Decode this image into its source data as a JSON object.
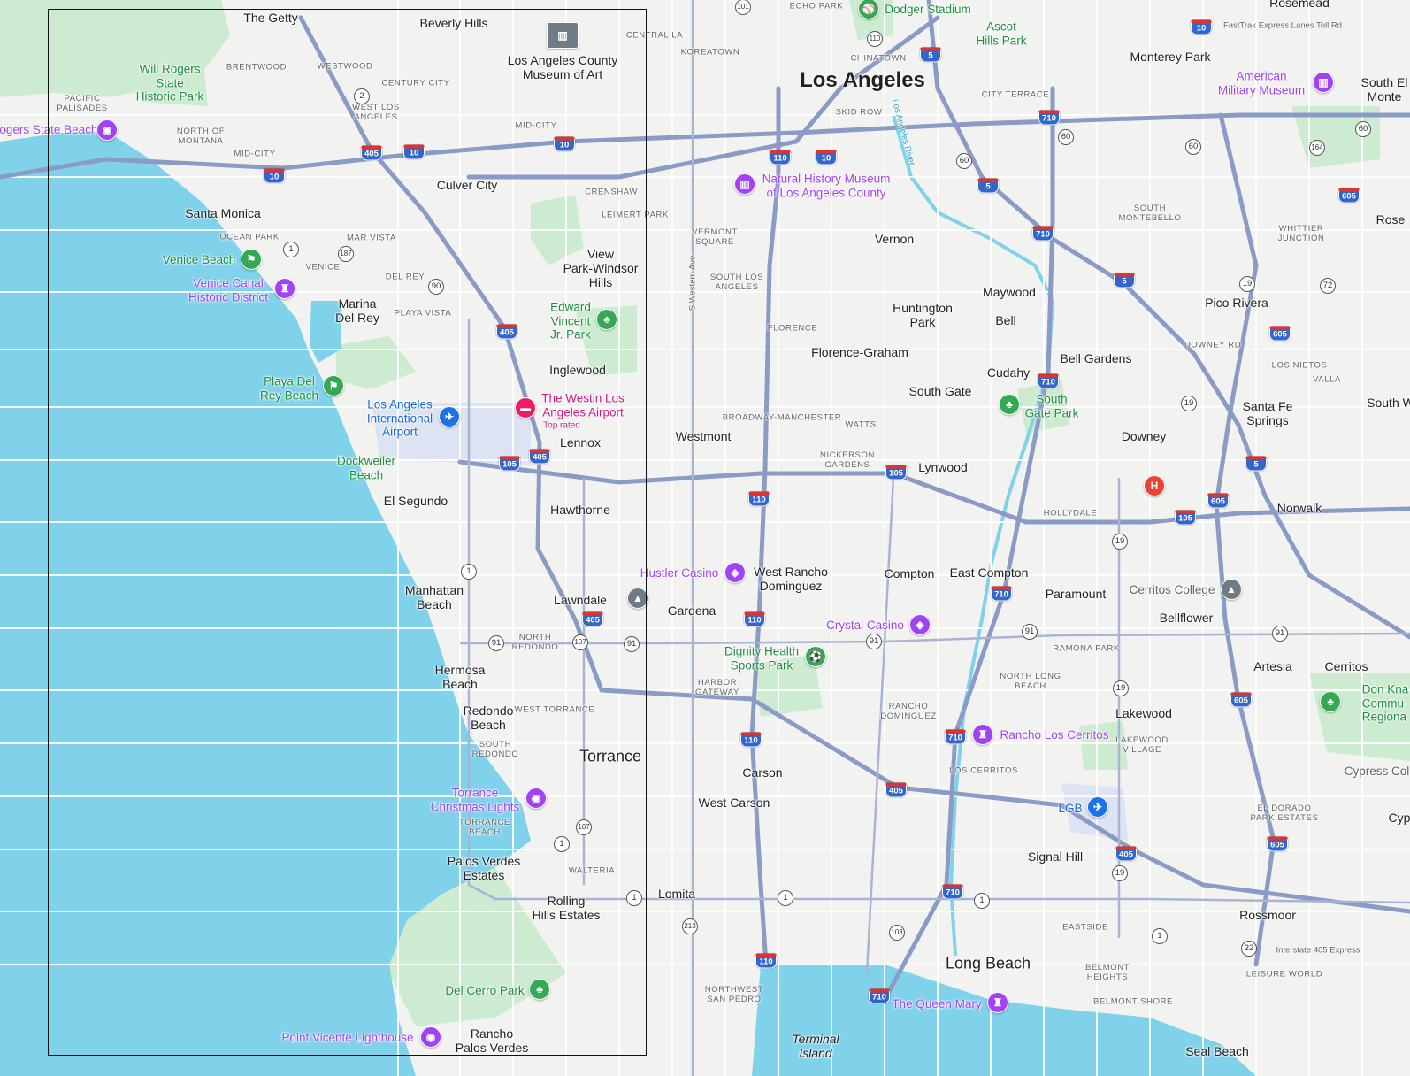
{
  "places": {
    "the_getty": "The Getty",
    "beverly_hills": "Beverly Hills",
    "brentwood": "BRENTWOOD",
    "westwood": "WESTWOOD",
    "will_rogers": "Will Rogers\nState\nHistoric Park",
    "pacific_palisades": "PACIFIC\nPALISADES",
    "rogers_state_beach": "Rogers State Beach",
    "century_city": "CENTURY CITY",
    "west_la": "WEST LOS\nANGELES",
    "north_montana": "NORTH OF\nMONTANA",
    "mid_city_west": "MID-CITY",
    "mid_city": "MID-CITY",
    "lacma": "Los Angeles County\nMuseum of Art",
    "central_la": "CENTRAL LA",
    "koreatown": "KOREATOWN",
    "culver_city": "Culver City",
    "crenshaw": "CRENSHAW",
    "leimert_park": "LEIMERT PARK",
    "santa_monica": "Santa Monica",
    "ocean_park": "OCEAN PARK",
    "mar_vista": "MAR VISTA",
    "venice_beach": "Venice Beach",
    "venice": "VENICE",
    "venice_canal": "Venice Canal\nHistoric District",
    "del_rey": "DEL REY",
    "marina_del_rey": "Marina\nDel Rey",
    "playa_vista": "PLAYA VISTA",
    "view_park": "View\nPark-Windsor\nHills",
    "edward_vincent": "Edward\nVincent\nJr. Park",
    "inglewood": "Inglewood",
    "playa_del_rey_beach": "Playa Del\nRey Beach",
    "lax": "Los Angeles\nInternational\nAirport",
    "westin": "The Westin Los\nAngeles Airport",
    "top_rated": "Top rated",
    "lennox": "Lennox",
    "dockweiler": "Dockweiler\nBeach",
    "el_segundo": "El Segundo",
    "hawthorne": "Hawthorne",
    "manhattan_beach": "Manhattan\nBeach",
    "lawndale": "Lawndale",
    "north_redondo": "NORTH\nREDONDO",
    "hermosa_beach": "Hermosa\nBeach",
    "redondo_beach": "Redondo\nBeach",
    "west_torrance": "WEST TORRANCE",
    "south_redondo": "SOUTH\nREDONDO",
    "torrance": "Torrance",
    "torrance_lights": "Torrance\nChristmas Lights",
    "torrance_beach": "TORRANCE\nBEACH",
    "palos_verdes_estates": "Palos Verdes\nEstates",
    "walteria": "WALTERIA",
    "rolling_hills": "Rolling\nHills Estates",
    "del_cerro": "Del Cerro Park",
    "point_vicente": "Point Vicente Lighthouse",
    "rancho_pv": "Rancho\nPalos Verdes",
    "lomita": "Lomita",
    "dodger_stadium": "Dodger Stadium",
    "echo_park": "ECHO PARK",
    "ascot_hills": "Ascot\nHills Park",
    "chinatown": "CHINATOWN",
    "los_angeles": "Los Angeles",
    "skid_row": "SKID ROW",
    "city_terrace": "CITY TERRACE",
    "monterey_park": "Monterey Park",
    "rosemead": "Rosemead",
    "american_military": "American\nMilitary Museum",
    "south_el_monte": "South El\nMonte",
    "natural_history": "Natural History Museum\nof Los Angeles County",
    "vermont_square": "VERMONT\nSQUARE",
    "south_la": "SOUTH LOS\nANGELES",
    "vernon": "Vernon",
    "south_montebello": "SOUTH\nMONTEBELLO",
    "whittier_junction": "WHITTIER\nJUNCTION",
    "rose_hills": "Rose",
    "maywood": "Maywood",
    "huntington_park": "Huntington\nPark",
    "bell": "Bell",
    "pico_rivera": "Pico Rivera",
    "florence": "FLORENCE",
    "florence_graham": "Florence-Graham",
    "cudahy": "Cudahy",
    "bell_gardens": "Bell Gardens",
    "downey_rd": "DOWNEY RD",
    "los_nietos": "LOS NIETOS",
    "valla": "VALLA",
    "south_gate": "South Gate",
    "south_gate_park": "South\nGate Park",
    "santa_fe_springs": "Santa Fe\nSprings",
    "south_whittier": "South W",
    "broadway_manchester": "BROADWAY-MANCHESTER",
    "watts": "WATTS",
    "westmont": "Westmont",
    "downey": "Downey",
    "nickerson_gardens": "NICKERSON\nGARDENS",
    "lynwood": "Lynwood",
    "hollydale": "HOLLYDALE",
    "norwalk": "Norwalk",
    "hustler_casino": "Hustler Casino",
    "west_rancho": "West Rancho\nDominguez",
    "compton": "Compton",
    "east_compton": "East Compton",
    "paramount": "Paramount",
    "cerritos_college": "Cerritos College",
    "gardena": "Gardena",
    "bellflower": "Bellflower",
    "crystal_casino": "Crystal Casino",
    "dignity_health": "Dignity Health\nSports Park",
    "ramona_park": "RAMONA PARK",
    "artesia": "Artesia",
    "cerritos": "Cerritos",
    "harbor_gateway": "HARBOR\nGATEWAY",
    "north_long_beach": "NORTH LONG\nBEACH",
    "lakewood": "Lakewood",
    "don_knabe": "Don Kna\nCommu\nRegiona",
    "rancho_dominguez": "RANCHO\nDOMINGUEZ",
    "rancho_los_cerritos": "Rancho Los Cerritos",
    "lakewood_village": "LAKEWOOD\nVILLAGE",
    "carson": "Carson",
    "los_cerritos": "LOS CERRITOS",
    "cypress_college": "Cypress Coll",
    "west_carson": "West Carson",
    "lgb": "LGB",
    "el_dorado": "EL DORADO\nPARK ESTATES",
    "cyp": "Cyp",
    "signal_hill": "Signal Hill",
    "rossmoor": "Rossmoor",
    "eastside": "EASTSIDE",
    "long_beach": "Long Beach",
    "belmont_heights": "BELMONT\nHEIGHTS",
    "leisure_world": "LEISURE WORLD",
    "northwest_san_pedro": "NORTHWEST\nSAN PEDRO",
    "queen_mary": "The Queen Mary",
    "belmont_shore": "BELMONT SHORE",
    "terminal_island": "Terminal\nIsland",
    "seal_beach": "Seal Beach",
    "fastrak": "FastTrak Express Lanes Toll Rd",
    "i405_express": "Interstate 405 Express",
    "s_western_ave": "S Western Ave",
    "la_river": "Los Angeles River"
  },
  "icons": [
    "museum-icon",
    "park-icon",
    "beach-icon",
    "landmark-icon",
    "airport-icon",
    "hotel-icon",
    "casino-icon",
    "stadium-icon",
    "school-icon",
    "hospital-icon",
    "lighthouse-icon"
  ],
  "colors": {
    "water": "#7fd2ea",
    "land": "#f2f3f1",
    "park": "#cdebd0",
    "highway": "#8a9bc5",
    "road": "#ffffff",
    "selection": "#111111"
  }
}
